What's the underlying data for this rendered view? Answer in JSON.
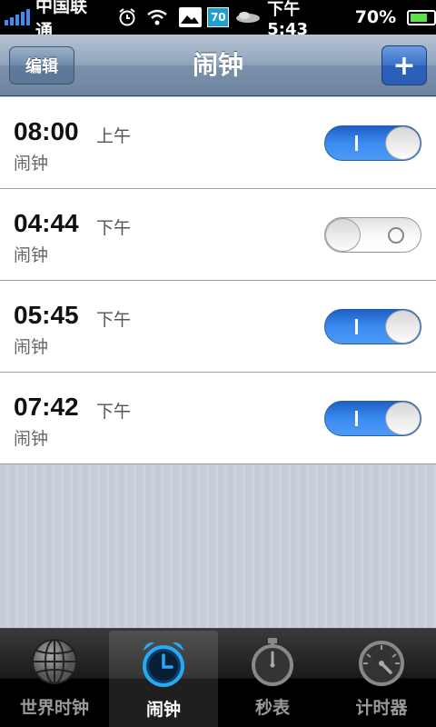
{
  "status_bar": {
    "carrier": "中国联通",
    "badge": "70",
    "time": "下午 5:43",
    "battery_pct": "70%",
    "battery_level": 0.7,
    "signal_bars": 5
  },
  "nav": {
    "title": "闹钟",
    "edit_label": "编辑",
    "add_label": "+"
  },
  "alarms": [
    {
      "time": "08:00",
      "period": "上午",
      "label": "闹钟",
      "enabled": true
    },
    {
      "time": "04:44",
      "period": "下午",
      "label": "闹钟",
      "enabled": false
    },
    {
      "time": "05:45",
      "period": "下午",
      "label": "闹钟",
      "enabled": true
    },
    {
      "time": "07:42",
      "period": "下午",
      "label": "闹钟",
      "enabled": true
    }
  ],
  "tabs": [
    {
      "label": "世界时钟",
      "icon": "globe-icon",
      "active": false
    },
    {
      "label": "闹钟",
      "icon": "alarm-clock-icon",
      "active": true
    },
    {
      "label": "秒表",
      "icon": "stopwatch-icon",
      "active": false
    },
    {
      "label": "计时器",
      "icon": "timer-icon",
      "active": false
    }
  ],
  "colors": {
    "toggle_on": "#3b8bf0",
    "active_tab_icon": "#28a9f2",
    "nav_accent": "#3b71c7"
  }
}
